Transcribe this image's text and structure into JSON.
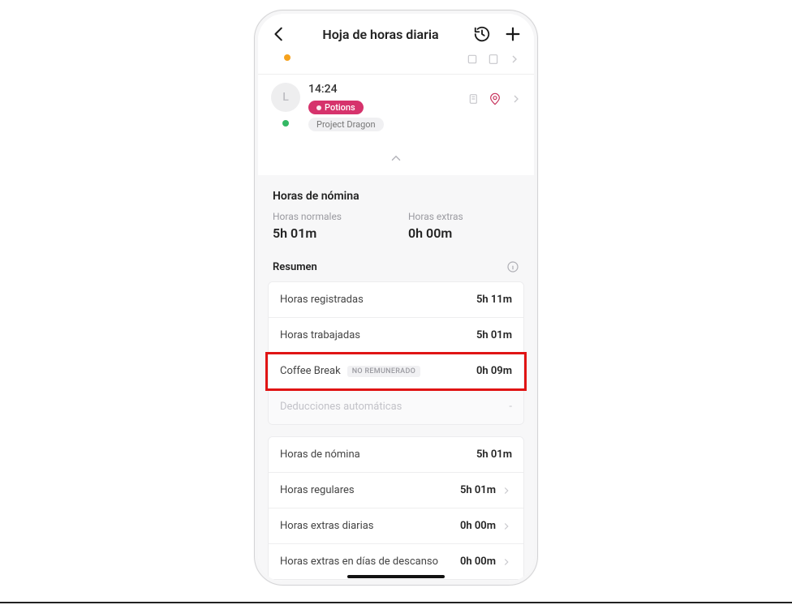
{
  "header": {
    "title": "Hoja de horas diaria"
  },
  "entry_partial": {
    "time_placeholder": "· · · ·"
  },
  "entry": {
    "avatar_initial": "L",
    "time": "14:24",
    "tag_primary": "Potions",
    "tag_secondary": "Project Dragon"
  },
  "payroll": {
    "section_title": "Horas de nómina",
    "cols": [
      {
        "label": "Horas normales",
        "value": "5h 01m"
      },
      {
        "label": "Horas extras",
        "value": "0h 00m"
      }
    ]
  },
  "resumen": {
    "title": "Resumen",
    "group1": [
      {
        "label": "Horas registradas",
        "value": "5h 11m"
      },
      {
        "label": "Horas trabajadas",
        "value": "5h 01m"
      },
      {
        "label": "Coffee Break",
        "badge": "NO REMUNERADO",
        "value": "0h 09m"
      },
      {
        "label": "Deducciones automáticas",
        "value": "-",
        "muted": true
      }
    ],
    "group2": [
      {
        "label": "Horas de nómina",
        "value": "5h 01m",
        "chevron": false
      },
      {
        "label": "Horas regulares",
        "value": "5h 01m",
        "chevron": true
      },
      {
        "label": "Horas extras diarias",
        "value": "0h 00m",
        "chevron": true
      },
      {
        "label": "Horas extras en días de descanso",
        "value": "0h 00m",
        "chevron": true
      }
    ]
  }
}
